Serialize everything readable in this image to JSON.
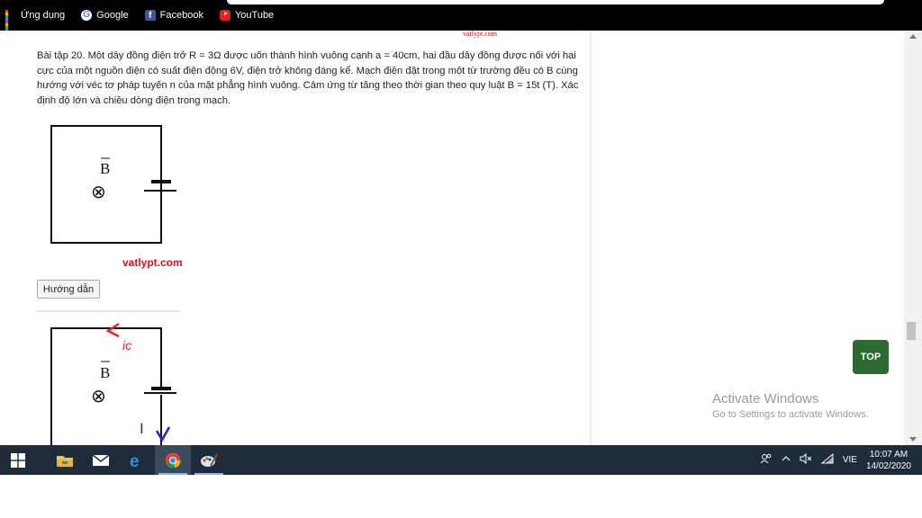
{
  "bookmarks": [
    {
      "label": "Ứng dụng",
      "icon": "apps-icon"
    },
    {
      "label": "Google",
      "icon": "google-icon"
    },
    {
      "label": "Facebook",
      "icon": "facebook-icon"
    },
    {
      "label": "YouTube",
      "icon": "youtube-icon"
    }
  ],
  "page": {
    "watermark_top": "vatlypt.com",
    "problem_text": "Bài tập 20. Một dây đồng điện trở R = 3Ω được uốn thành hình vuông cạnh a = 40cm, hai đầu dây đồng được nối với hai cực của một nguồn điện có suất điện động 6V, điện trở không đáng kể. Mạch điện đặt trong một từ trường đều có B cùng hướng với véc tơ pháp tuyến n của mặt phẳng hình vuông. Cảm ứng từ tăng theo thời gian theo quy luật B = 15t (T). Xác định độ lớn và chiều dòng điện trong mạch.",
    "figure1": {
      "field_label": "B",
      "symbol": "⊗",
      "watermark": "vatlypt.com"
    },
    "guide_button": "Hướng dẫn",
    "figure2": {
      "field_label": "B",
      "symbol": "⊗",
      "current_label": "I",
      "induced_label": "ic"
    },
    "top_button": "TOP"
  },
  "activation": {
    "title": "Activate Windows",
    "subtitle": "Go to Settings to activate Windows."
  },
  "taskbar": {
    "apps": [
      "start-button",
      "file-explorer",
      "mail",
      "edge",
      "chrome",
      "paint"
    ],
    "language": "VIE",
    "time": "10:07 AM",
    "date": "14/02/2020"
  },
  "colors": {
    "top_button": "#2d6a31",
    "watermark": "#d11",
    "taskbar": "#1d2b3a"
  }
}
